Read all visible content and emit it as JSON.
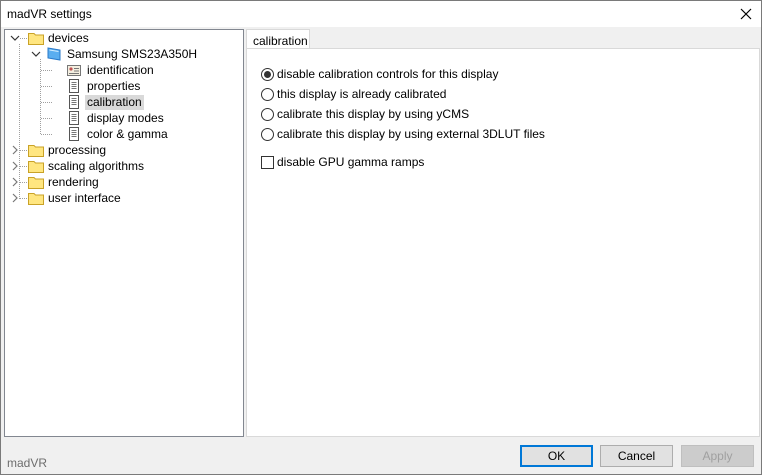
{
  "window": {
    "title": "madVR settings",
    "footer_label": "madVR"
  },
  "tree": {
    "devices": "devices",
    "device_name": "Samsung SMS23A350H",
    "device_children": [
      "identification",
      "properties",
      "calibration",
      "display modes",
      "color & gamma"
    ],
    "selected": "calibration",
    "root_items": [
      "processing",
      "scaling algorithms",
      "rendering",
      "user interface"
    ]
  },
  "tab": {
    "label": "calibration"
  },
  "options": {
    "radios": [
      {
        "label": "disable calibration controls for this display",
        "checked": true
      },
      {
        "label": "this display is already calibrated",
        "checked": false
      },
      {
        "label": "calibrate this display by using yCMS",
        "checked": false
      },
      {
        "label": "calibrate this display by using external 3DLUT files",
        "checked": false
      }
    ],
    "checkbox": {
      "label": "disable GPU gamma ramps",
      "checked": false
    }
  },
  "buttons": {
    "ok": "OK",
    "cancel": "Cancel",
    "apply": "Apply"
  }
}
